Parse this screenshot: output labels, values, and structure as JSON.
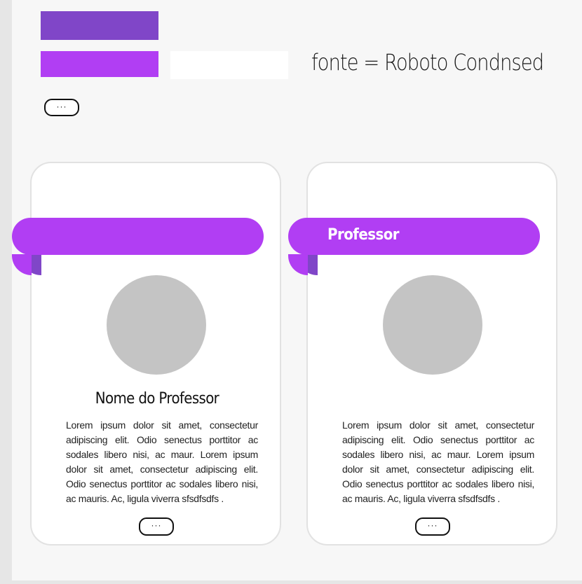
{
  "palette": {
    "dark_purple": "#8046c8",
    "accent_purple": "#b13ef3",
    "white": "#ffffff",
    "avatar_gray": "#c4c4c4"
  },
  "font_note": "fonte = Roboto Condnsed",
  "top_button": {
    "label": "···"
  },
  "cards": [
    {
      "ribbon_label": "",
      "name": "Nome do Professor",
      "body": "Lorem ipsum dolor sit amet, consectetur adipiscing elit. Odio senectus porttitor ac sodales libero nisi, ac maur. Lorem ipsum dolor sit amet, consectetur adipiscing elit. Odio senectus porttitor ac sodales libero nisi, ac mauris. Ac, ligula viverra sfsdfsdfs .",
      "button_label": "···"
    },
    {
      "ribbon_label": "Professor",
      "name": "",
      "body": "Lorem ipsum dolor sit amet, consectetur adipiscing elit. Odio senectus porttitor ac sodales libero nisi, ac maur. Lorem ipsum dolor sit amet, consectetur adipiscing elit. Odio senectus porttitor ac sodales libero nisi, ac mauris. Ac, ligula viverra sfsdfsdfs .",
      "button_label": "···"
    }
  ]
}
